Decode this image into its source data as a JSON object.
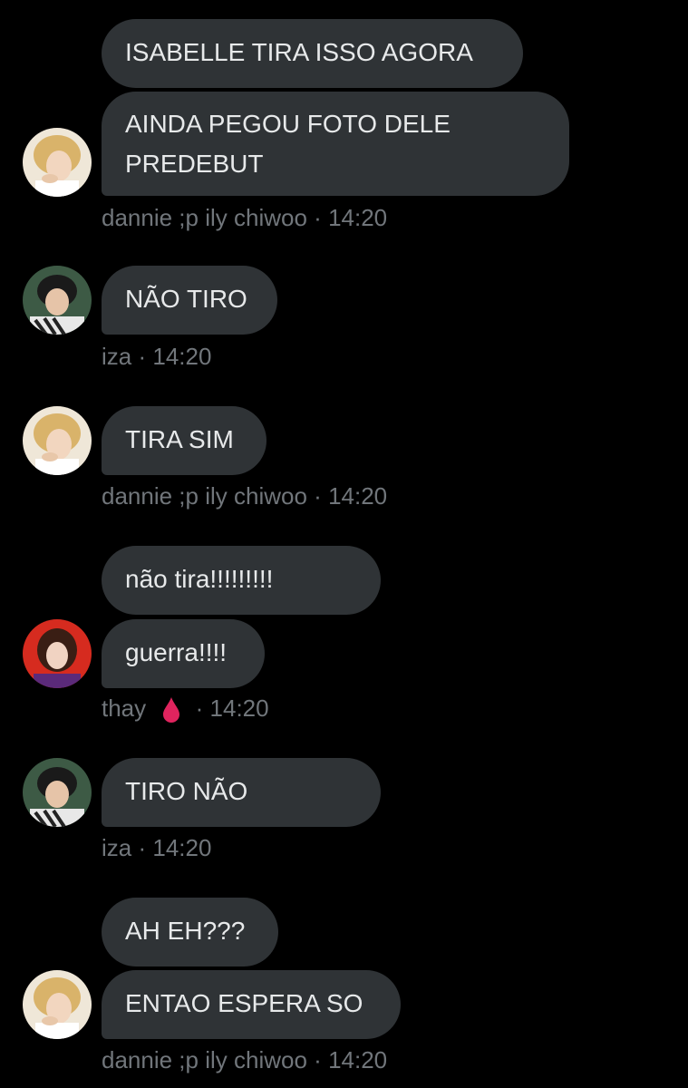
{
  "colors": {
    "background": "#000000",
    "bubble": "#2f3336",
    "bubble_text": "#e7e9ea",
    "meta_text": "#71767b",
    "drop": "#e0245e"
  },
  "messages": [
    {
      "sender": "dannie ;p ily chiwoo",
      "text": "ISABELLE TIRA ISSO AGORA"
    },
    {
      "sender": "dannie ;p ily chiwoo",
      "text_line1": "AINDA PEGOU FOTO DELE",
      "text_line2": "PREDEBUT"
    },
    {
      "sender": "iza",
      "text": "NÃO TIRO"
    },
    {
      "sender": "dannie ;p ily chiwoo",
      "text": "TIRA SIM"
    },
    {
      "sender": "thay",
      "text": "não tira!!!!!!!!!"
    },
    {
      "sender": "thay",
      "text": "guerra!!!!"
    },
    {
      "sender": "iza",
      "text": "TIRO NÃO"
    },
    {
      "sender": "dannie ;p ily chiwoo",
      "text": "AH EH???"
    },
    {
      "sender": "dannie ;p ily chiwoo",
      "text": "ENTAO ESPERA SO"
    }
  ],
  "meta": [
    {
      "name": "dannie ;p ily chiwoo",
      "separator": "·",
      "time": "14:20"
    },
    {
      "name": "iza",
      "separator": "·",
      "time": "14:20"
    },
    {
      "name": "dannie ;p ily chiwoo",
      "separator": "·",
      "time": "14:20"
    },
    {
      "name": "thay",
      "emoji_icon": "red-drop-icon",
      "separator": "·",
      "time": "14:20"
    },
    {
      "name": "iza",
      "separator": "·",
      "time": "14:20"
    },
    {
      "name": "dannie ;p ily chiwoo",
      "separator": "·",
      "time": "14:20"
    }
  ]
}
